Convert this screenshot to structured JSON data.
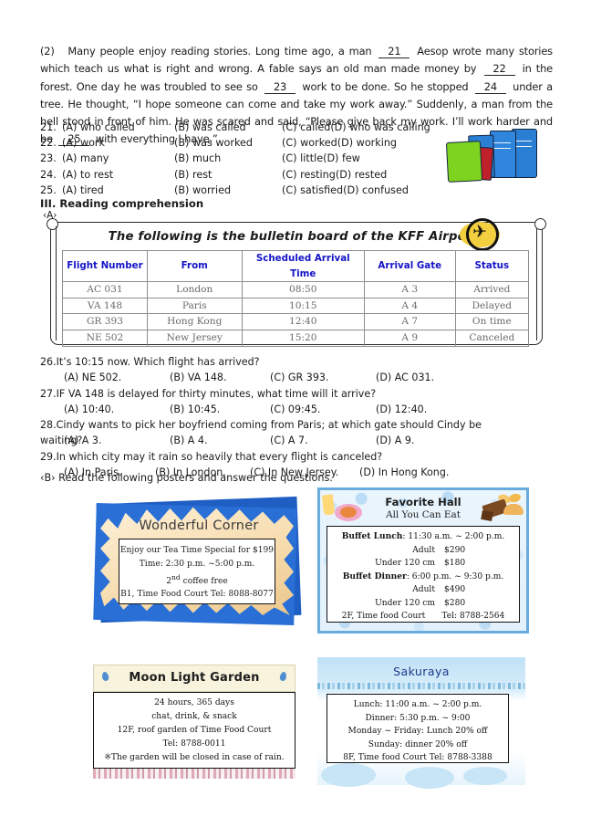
{
  "passage": {
    "number": "(2)",
    "part1": "Many people enjoy reading stories. Long time ago, a man",
    "b21": "21",
    "part2": "Aesop wrote many stories which teach us what is right and wrong. A fable says an old man made money by",
    "b22": "22",
    "part3": "in the forest. One day he was troubled to see so",
    "b23": "23",
    "part4": "work to be done. So he stopped",
    "b24": "24",
    "part5": "under a tree. He thought, “I hope someone can come and take my work away.” Suddenly, a man from the hell stood in front of him. He was scared and said, “Please give back my work. I’ll work harder and be",
    "b25": "25",
    "part6": "with everything I have.”"
  },
  "cloze_choices": [
    {
      "num": "21.",
      "a": "(A) who called",
      "b": "(B) was called",
      "c": "(C) called",
      "d": "(D) who was calling"
    },
    {
      "num": "22.",
      "a": "(A) work",
      "b": "(B) was worked",
      "c": "(C) worked",
      "d": "(D) working"
    },
    {
      "num": "23.",
      "a": "(A) many",
      "b": "(B) much",
      "c": "(C) little",
      "d": "(D) few"
    },
    {
      "num": "24.",
      "a": "(A) to rest",
      "b": "(B) rest",
      "c": "(C) resting",
      "d": "(D) rested"
    },
    {
      "num": "25.",
      "a": "(A) tired",
      "b": "(B) worried",
      "c": "(C) satisfied",
      "d": "(D) confused"
    }
  ],
  "section": {
    "heading": "III. Reading comprehension",
    "sub_a": "‹A›",
    "sub_b": "‹B› Read the following posters and answer the questions."
  },
  "bulletin": {
    "title": "The following is the bulletin board of the KFF Airport.",
    "plane_icon": "✈",
    "headers": [
      "Flight Number",
      "From",
      "Scheduled Arrival Time",
      "Arrival Gate",
      "Status"
    ],
    "rows": [
      [
        "AC 031",
        "London",
        "08:50",
        "A 3",
        "Arrived"
      ],
      [
        "VA 148",
        "Paris",
        "10:15",
        "A 4",
        "Delayed"
      ],
      [
        "GR 393",
        "Hong Kong",
        "12:40",
        "A 7",
        "On time"
      ],
      [
        "NE 502",
        "New Jersey",
        "15:20",
        "A 9",
        "Canceled"
      ]
    ]
  },
  "reading_questions": [
    {
      "q": "26.It’s 10:15 now. Which flight has arrived?",
      "a": "(A) NE 502.",
      "b": "(B) VA 148.",
      "c": "(C) GR 393.",
      "d": "(D) AC 031."
    },
    {
      "q": "27.IF VA 148 is delayed for thirty minutes, what time will it arrive?",
      "a": "(A) 10:40.",
      "b": "(B) 10:45.",
      "c": "(C) 09:45.",
      "d": "(D) 12:40."
    },
    {
      "q": "28.Cindy wants to pick her boyfriend coming from Paris; at which gate should Cindy be waiting?",
      "a": "(A) A 3.",
      "b": "(B) A 4.",
      "c": "(C) A 7.",
      "d": "(D) A 9."
    },
    {
      "q": "29.In which city may it rain so heavily that every flight is canceled?",
      "a": "(A) In Paris.",
      "b": "(B) In London.",
      "c": "(C) In New Jersey.",
      "d": "(D) In Hong Kong."
    }
  ],
  "posters": {
    "wonderful_corner": {
      "title": "Wonderful Corner",
      "line1": "Enjoy our Tea Time Special for $199",
      "line2": "Time: 2:30 p.m. ~5:00 p.m.",
      "line3_sup": "2",
      "line3_sup_ord": "nd",
      "line3_rest": " coffee free",
      "line4": "B1, Time Food Court     Tel: 8088-8077"
    },
    "favorite_hall": {
      "title": "Favorite Hall",
      "subtitle": "All You Can Eat",
      "lunch_head": "Buffet Lunch",
      "lunch_time": ": 11:30 a.m. ~ 2:00 p.m.",
      "lunch_adult_label": "Adult",
      "lunch_adult_price": "$290",
      "lunch_child_label": "Under 120 cm",
      "lunch_child_price": "$180",
      "dinner_head": "Buffet Dinner",
      "dinner_time": ": 6:00 p.m. ~ 9:30 p.m.",
      "dinner_adult_label": "Adult",
      "dinner_adult_price": "$490",
      "dinner_child_label": "Under 120 cm",
      "dinner_child_price": "$280",
      "location": "2F, Time food Court",
      "tel": "Tel: 8788-2564"
    },
    "moon_light_garden": {
      "title": "Moon Light Garden",
      "line1": "24 hours, 365 days",
      "line2": "chat, drink, & snack",
      "line3": "12F, roof garden of Time Food Court",
      "line4": "Tel: 8788-0011",
      "line5": "※The garden will be closed in case of rain."
    },
    "sakuraya": {
      "title": "Sakuraya",
      "line1": "Lunch: 11:00 a.m. ~ 2:00 p.m.",
      "line2": "Dinner: 5:30 p.m. ~ 9:00",
      "line3": "Monday ~ Friday: Lunch 20% off",
      "line4": "Sunday: dinner 20% off",
      "line5": "8F, Time food Court     Tel: 8788-3388"
    }
  },
  "colors": {
    "header_blue": "#1414c8",
    "table_body_gray": "#6a6a6a",
    "poster_blue": "#1f5fc4",
    "sakuraya_blue": "#1b3a8a"
  }
}
